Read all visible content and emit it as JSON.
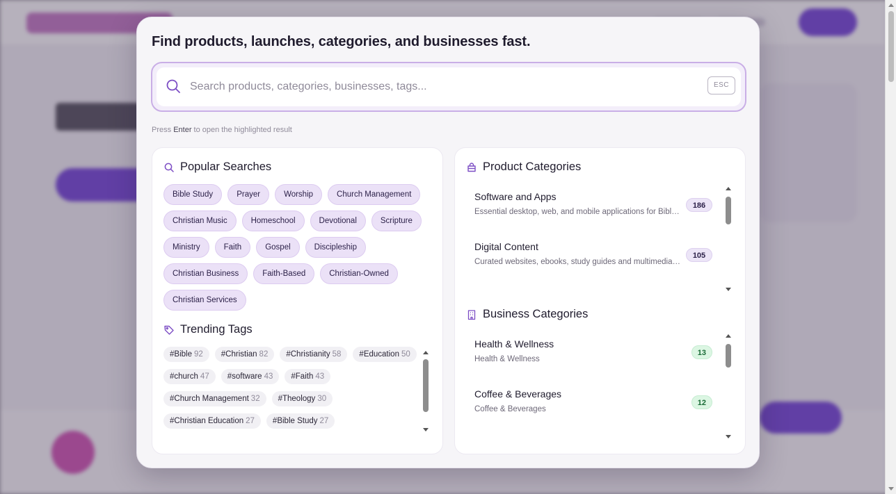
{
  "modal": {
    "title": "Find products, launches, categories, and businesses fast.",
    "search": {
      "placeholder": "Search products, categories, businesses, tags...",
      "value": "",
      "esc_label": "ESC"
    },
    "hint": {
      "prefix": "Press ",
      "key": "Enter",
      "suffix": " to open the highlighted result"
    }
  },
  "popular": {
    "title": "Popular Searches",
    "items": [
      "Bible Study",
      "Prayer",
      "Worship",
      "Church Management",
      "Christian Music",
      "Homeschool",
      "Devotional",
      "Scripture",
      "Ministry",
      "Faith",
      "Gospel",
      "Discipleship",
      "Christian Business",
      "Faith-Based",
      "Christian-Owned",
      "Christian Services"
    ]
  },
  "trending": {
    "title": "Trending Tags",
    "items": [
      {
        "tag": "#Bible",
        "count": "92"
      },
      {
        "tag": "#Christian",
        "count": "82"
      },
      {
        "tag": "#Christianity",
        "count": "58"
      },
      {
        "tag": "#Education",
        "count": "50"
      },
      {
        "tag": "#church",
        "count": "47"
      },
      {
        "tag": "#software",
        "count": "43"
      },
      {
        "tag": "#Faith",
        "count": "43"
      },
      {
        "tag": "#Church Management",
        "count": "32"
      },
      {
        "tag": "#Theology",
        "count": "30"
      },
      {
        "tag": "#Christian Education",
        "count": "27"
      },
      {
        "tag": "#Bible Study",
        "count": "27"
      }
    ]
  },
  "product_categories": {
    "title": "Product Categories",
    "items": [
      {
        "name": "Software and Apps",
        "desc": "Essential desktop, web, and mobile applications for Bible study, church management, and Christian living",
        "count": "186"
      },
      {
        "name": "Digital Content",
        "desc": "Curated websites, ebooks, study guides and multimedia resources",
        "count": "105"
      }
    ]
  },
  "business_categories": {
    "title": "Business Categories",
    "items": [
      {
        "name": "Health & Wellness",
        "desc": "Health & Wellness",
        "count": "13"
      },
      {
        "name": "Coffee & Beverages",
        "desc": "Coffee & Beverages",
        "count": "12"
      }
    ]
  },
  "colors": {
    "accent": "#7c4dc4",
    "chip_bg": "#ebe1f7",
    "badge_green_bg": "#dcf6e3",
    "badge_green_text": "#1a6b37"
  },
  "icons": {
    "search": "search-icon",
    "popular": "search-icon",
    "trending": "tag-icon",
    "product": "bag-icon",
    "business": "building-icon"
  }
}
